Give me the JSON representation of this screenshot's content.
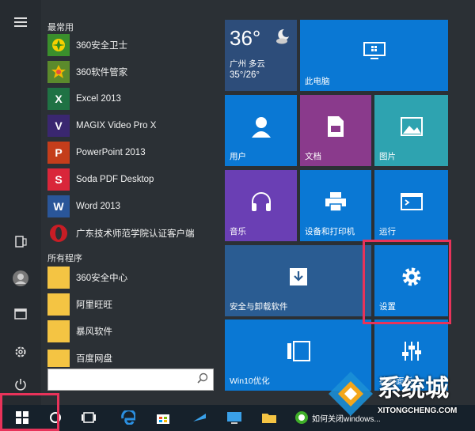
{
  "frequent_section": "最常用",
  "all_programs_section": "所有程序",
  "frequent_apps": [
    {
      "label": "360安全卫士",
      "icon": "360-safe-icon",
      "color": "#3a8f2c"
    },
    {
      "label": "360软件管家",
      "icon": "360-software-manager-icon",
      "color": "#e0a300"
    },
    {
      "label": "Excel 2013",
      "icon": "excel-icon",
      "color": "#1f7244"
    },
    {
      "label": "MAGIX Video Pro X",
      "icon": "magix-icon",
      "color": "#3a2770"
    },
    {
      "label": "PowerPoint 2013",
      "icon": "powerpoint-icon",
      "color": "#c43d1b"
    },
    {
      "label": "Soda PDF Desktop",
      "icon": "soda-pdf-icon",
      "color": "#d9263a"
    },
    {
      "label": "Word 2013",
      "icon": "word-icon",
      "color": "#2a5699"
    },
    {
      "label": "广东技术师范学院认证客户端",
      "icon": "opera-icon",
      "color": "#c81d25"
    }
  ],
  "all_apps": [
    {
      "label": "360安全中心",
      "icon": "folder-icon",
      "color": "#f4c443"
    },
    {
      "label": "阿里旺旺",
      "icon": "folder-icon",
      "color": "#f4c443"
    },
    {
      "label": "暴风软件",
      "icon": "folder-icon",
      "color": "#f4c443"
    },
    {
      "label": "百度网盘",
      "icon": "folder-icon",
      "color": "#f4c443"
    }
  ],
  "weather": {
    "temp": "36°",
    "city": "广州 多云",
    "range": "35°/26°"
  },
  "tiles": {
    "this_pc": "此电脑",
    "user": "用户",
    "documents": "文档",
    "pictures": "图片",
    "music": "音乐",
    "devices_printers": "设备和打印机",
    "run": "运行",
    "security_download": "安全与卸载软件",
    "settings": "设置",
    "win10_optimize": "Win10优化",
    "control_panel": "控制面板"
  },
  "taskbar_item_text": "如何关闭windows...",
  "watermark": {
    "brand": "系统城",
    "url": "XITONGCHENG.COM"
  },
  "colors": {
    "highlight": "#e8335a",
    "tile_blue": "#0a78d4",
    "tile_purple": "#6a3fb4",
    "tile_teal": "#2ea3b0"
  }
}
